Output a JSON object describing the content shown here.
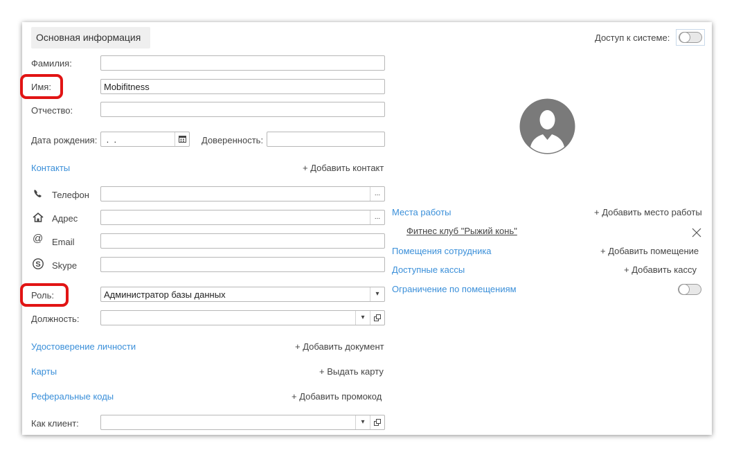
{
  "tab": {
    "title": "Основная информация"
  },
  "access": {
    "label": "Доступ к системе:",
    "enabled": false
  },
  "fields": {
    "last_name": {
      "label": "Фамилия:",
      "value": ""
    },
    "first_name": {
      "label": "Имя:",
      "value": "Mobifitness"
    },
    "patronymic": {
      "label": "Отчество:",
      "value": ""
    },
    "birth_date": {
      "label": "Дата рождения:",
      "value": " .  ."
    },
    "proxy": {
      "label": "Доверенность:",
      "value": ""
    },
    "role": {
      "label": "Роль:",
      "value": "Администратор базы данных"
    },
    "position": {
      "label": "Должность:",
      "value": ""
    },
    "as_client": {
      "label": "Как клиент:",
      "value": ""
    }
  },
  "contacts": {
    "title": "Контакты",
    "add": "+ Добавить контакт",
    "items": [
      {
        "label": "Телефон",
        "icon": "phone-icon",
        "value": ""
      },
      {
        "label": "Адрес",
        "icon": "home-icon",
        "value": ""
      },
      {
        "label": "Email",
        "icon": "at-icon",
        "value": ""
      },
      {
        "label": "Skype",
        "icon": "skype-icon",
        "value": ""
      }
    ]
  },
  "sections": {
    "identity": {
      "title": "Удостоверение личности",
      "action": "+ Добавить документ"
    },
    "cards": {
      "title": "Карты",
      "action": "+ Выдать карту"
    },
    "referral": {
      "title": "Реферальные коды",
      "action": "+ Добавить промокод"
    }
  },
  "right": {
    "workplaces": {
      "title": "Места работы",
      "action": "+ Добавить место работы",
      "items": [
        "Фитнес клуб \"Рыжий конь\""
      ]
    },
    "rooms": {
      "title": "Помещения сотрудника",
      "action": "+ Добавить помещение"
    },
    "registers": {
      "title": "Доступные кассы",
      "action": "+ Добавить кассу"
    },
    "room_limit": {
      "title": "Ограничение по помещениям",
      "enabled": false
    }
  },
  "colors": {
    "link": "#3a8fd9",
    "highlight": "#e11414",
    "avatar": "#7a7a7a"
  }
}
